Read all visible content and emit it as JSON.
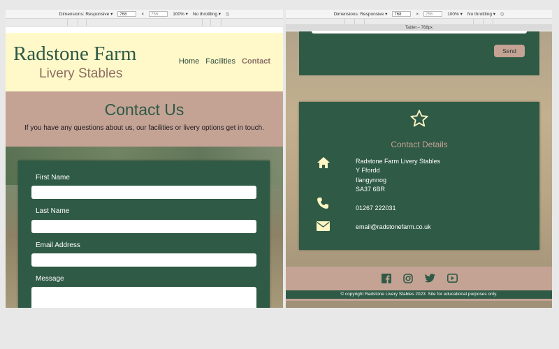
{
  "devtools": {
    "dimensions_label": "Dimensions: Responsive",
    "width": "768",
    "height": "756",
    "zoom": "100%",
    "throttling": "No throttling",
    "tablet_label": "Tablet – 768px"
  },
  "site": {
    "brand_title": "Radstone Farm",
    "brand_subtitle": "Livery Stables",
    "nav": [
      "Home",
      "Facilities",
      "Contact"
    ],
    "active_nav": "Contact"
  },
  "hero": {
    "title": "Contact Us",
    "subtitle": "If you have any questions about us, our facilities or livery options get in touch."
  },
  "form": {
    "labels": [
      "First Name",
      "Last Name",
      "Email Address",
      "Message"
    ],
    "send_label": "Send"
  },
  "contact": {
    "title": "Contact Details",
    "address_lines": [
      "Radstone Farm Livery Stables",
      "Y Ffordd",
      "Ilangynnog",
      "SA37 6BR"
    ],
    "phone": "01267 222031",
    "email": "email@radstonefarm.co.uk"
  },
  "footer": {
    "social": [
      "facebook-icon",
      "instagram-icon",
      "twitter-icon",
      "youtube-icon"
    ],
    "copyright": "© copyright Radstone Livery Stables 2023. Site for educational purposes only."
  },
  "colors": {
    "green": "#2f5a46",
    "tan": "#c4a395",
    "cream": "#fff9c9",
    "cream_icon": "#fff6c3"
  }
}
